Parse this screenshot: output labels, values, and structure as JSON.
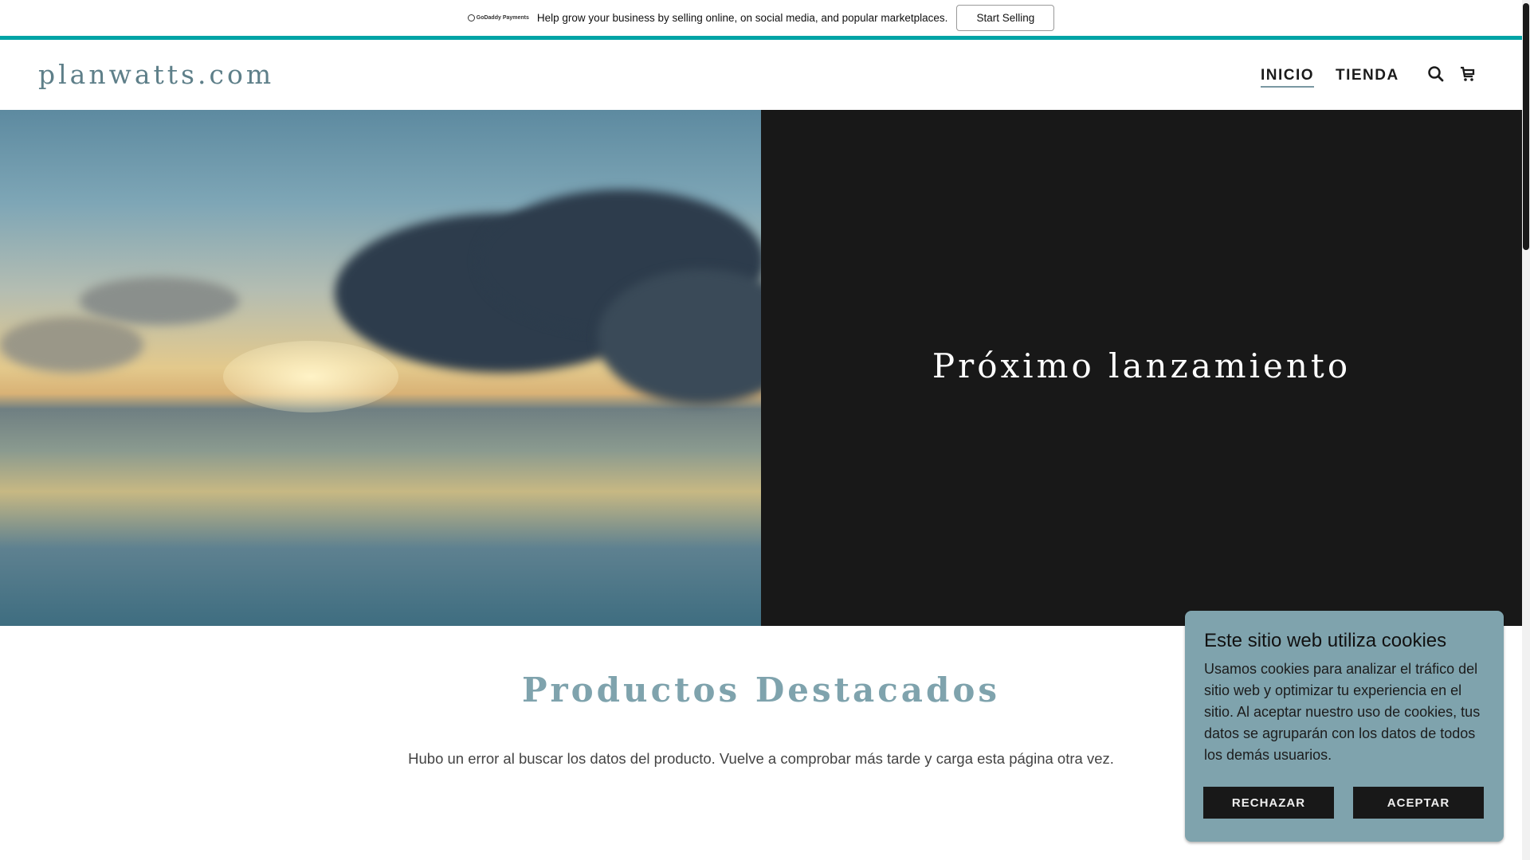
{
  "banner": {
    "brand": "GoDaddy Payments",
    "message": "Help grow your business by selling online, on social media, and popular marketplaces.",
    "button": "Start Selling"
  },
  "header": {
    "logo": "planwatts.com",
    "nav": [
      {
        "label": "INICIO",
        "active": true
      },
      {
        "label": "TIENDA",
        "active": false
      }
    ]
  },
  "hero": {
    "title": "Próximo lanzamiento"
  },
  "featured": {
    "title": "Productos Destacados",
    "error": "Hubo un error al buscar los datos del producto. Vuelve a comprobar más tarde y carga esta página otra vez."
  },
  "cookie": {
    "title": "Este sitio web utiliza cookies",
    "body": "Usamos cookies para analizar el tráfico del sitio web y optimizar tu experiencia en el sitio. Al aceptar nuestro uso de cookies, tus datos se agruparán con los datos de todos los demás usuarios.",
    "reject": "RECHAZAR",
    "accept": "ACEPTAR"
  },
  "colors": {
    "accent": "#7fa3ad",
    "teal": "#00a4a6",
    "dark": "#181818"
  }
}
